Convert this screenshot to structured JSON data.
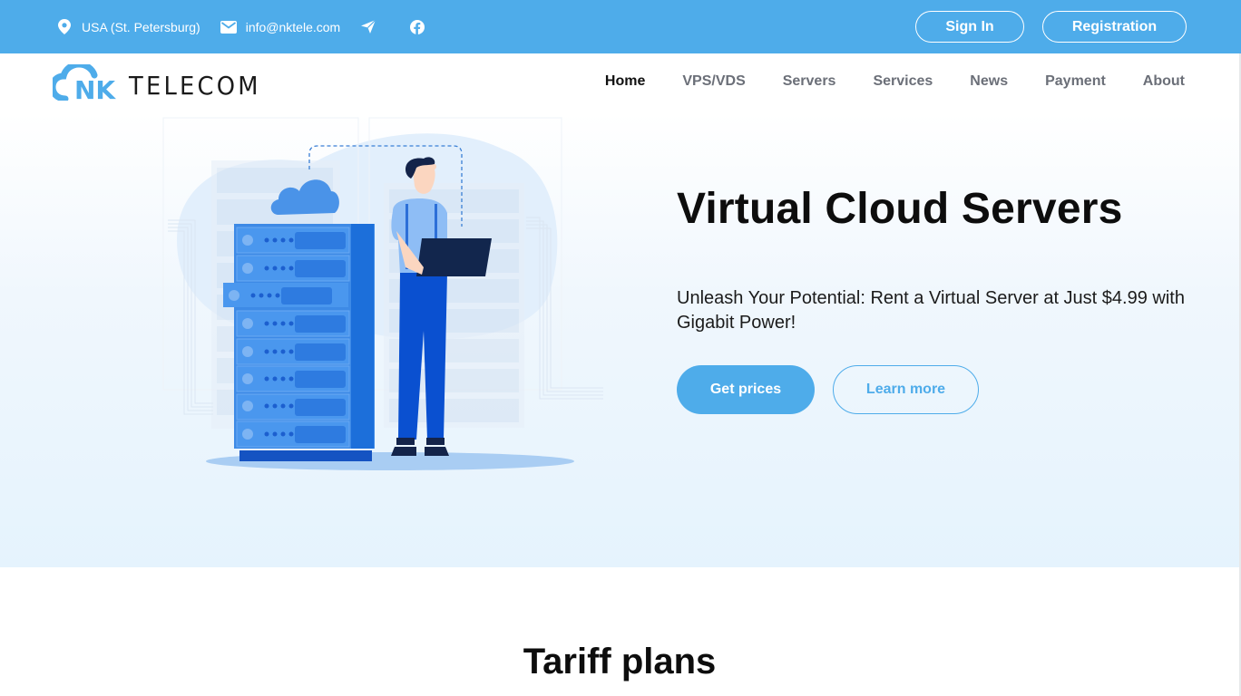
{
  "topbar": {
    "location": {
      "icon": "map-pin-icon",
      "text": "USA (St. Petersburg)"
    },
    "email": {
      "icon": "envelope-icon",
      "text": "info@nktele.com"
    },
    "social": [
      {
        "icon": "telegram-icon",
        "label": "Telegram"
      },
      {
        "icon": "facebook-icon",
        "label": "Facebook"
      }
    ],
    "sign_in_label": "Sign In",
    "registration_label": "Registration"
  },
  "brand": {
    "logo_mark": "NK",
    "logo_text": "TELECOM",
    "accent_color": "#4eacea"
  },
  "nav": {
    "items": [
      {
        "label": "Home",
        "active": true
      },
      {
        "label": "VPS/VDS",
        "active": false
      },
      {
        "label": "Servers",
        "active": false
      },
      {
        "label": "Services",
        "active": false
      },
      {
        "label": "News",
        "active": false
      },
      {
        "label": "Payment",
        "active": false
      },
      {
        "label": "About",
        "active": false
      }
    ]
  },
  "hero": {
    "illustration": "server-rack-with-engineer-illustration",
    "title": "Virtual Cloud Servers",
    "subtitle": "Unleash Your Potential: Rent a Virtual Server at Just $4.99 with Gigabit Power!",
    "primary_button": "Get prices",
    "secondary_button": "Learn more"
  },
  "tariffs": {
    "heading": "Tariff plans"
  }
}
